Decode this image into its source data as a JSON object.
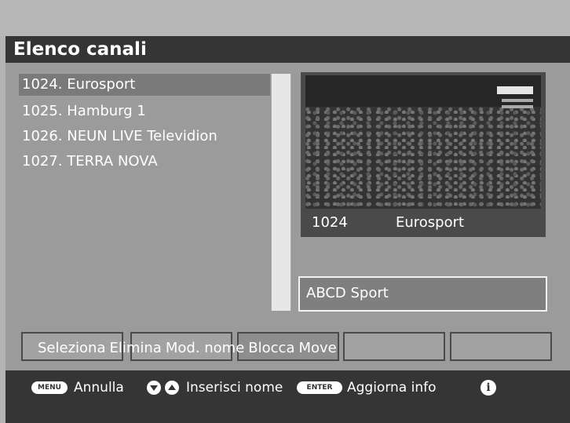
{
  "header": {
    "title": "Elenco canali"
  },
  "channels": [
    {
      "label": "1024. Eurosport",
      "selected": true
    },
    {
      "label": "1025. Hamburg 1",
      "selected": false
    },
    {
      "label": "1026. NEUN LIVE Televidion",
      "selected": false
    },
    {
      "label": "1027. TERRA NOVA",
      "selected": false
    }
  ],
  "preview": {
    "number": "1024",
    "name": "Eurosport"
  },
  "info_box": {
    "text": "ABCD Sport"
  },
  "actions": {
    "select": "Seleziona",
    "delete": "Elimina",
    "rename": "Mod. nome",
    "lock": "Blocca",
    "move": "Move"
  },
  "footer": {
    "menu_key": "MENU",
    "menu_label": "Annulla",
    "nav_label": "Inserisci nome",
    "enter_key": "ENTER",
    "enter_label": "Aggiorna info"
  },
  "icons": {
    "info": "info-icon",
    "down": "arrow-down-icon",
    "up": "arrow-up-icon"
  },
  "colors": {
    "title_bar": "#353535",
    "panel": "#9b9b9b",
    "selected_row": "#7a7a7a"
  }
}
